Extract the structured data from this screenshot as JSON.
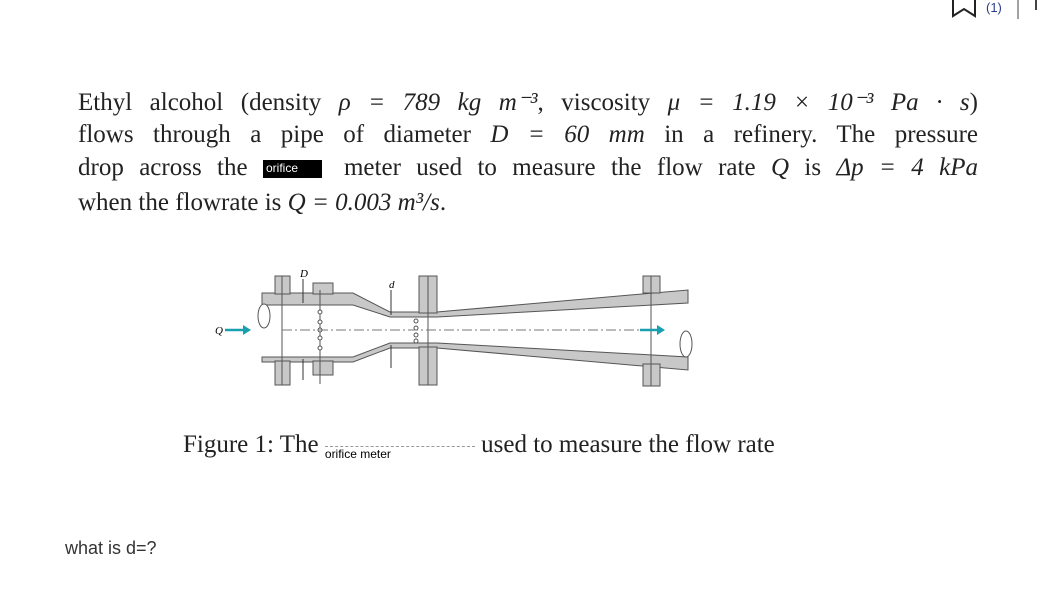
{
  "toolbar": {
    "icons": [
      "bookmark-icon"
    ],
    "count_label": "(1)"
  },
  "problem": {
    "line1": {
      "a": "Ethyl alcohol (density ",
      "m1": "ρ = 789 kg m⁻³",
      "b": ", viscosity ",
      "m2": "μ = 1.19 × 10⁻³ Pa · s",
      "c": ")"
    },
    "line2": {
      "a": "flows through a pipe of diameter ",
      "m1": "D = 60 mm",
      "b": " in a refinery. The pressure"
    },
    "line3": {
      "a": "drop across the ",
      "overlay": "orifice",
      "b": "meter used to measure the flow rate ",
      "m1": "Q",
      "c": " is ",
      "m2": "Δp = 4 kPa"
    },
    "line4": {
      "a": "when the flowrate is ",
      "m1": "Q = 0.003 m³/s",
      "b": "."
    }
  },
  "figure": {
    "labels": {
      "D": "D",
      "d": "d",
      "Q": "Q"
    },
    "caption_prefix": "Figure 1: The ",
    "caption_overlay": "orifice meter",
    "caption_suffix": " used to measure the flow rate",
    "colors": {
      "pipe_fill": "#c8c8c8",
      "arrow": "#1a9fb0"
    }
  },
  "question": "what is d=?"
}
